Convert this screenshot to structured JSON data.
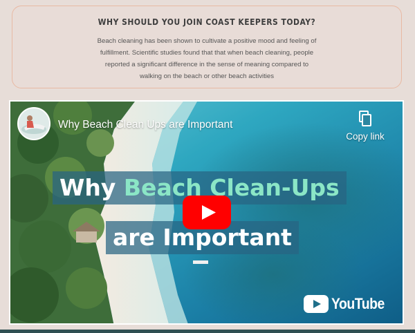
{
  "info_card": {
    "title": "WHY SHOULD YOU JOIN COAST KEEPERS TODAY?",
    "body_lines": [
      "Beach cleaning has been shown to cultivate a positive mood and feeling of",
      "fulfillment. Scientific studies found that that when beach cleaning, people",
      "reported a significant difference in the sense of meaning compared to",
      "walking on the beach or other beach activities"
    ]
  },
  "video": {
    "title": "Why Beach Clean Ups are Important",
    "copy_link_label": "Copy link",
    "overlay_line1_plain": "Why ",
    "overlay_line1_accent": "Beach Clean-Ups",
    "overlay_line2": "are Important",
    "platform_name": "YouTube",
    "icons": {
      "copy": "copy-icon",
      "play": "play-icon",
      "youtube": "youtube-logo-icon"
    },
    "colors": {
      "play_red": "#ff0000",
      "overlay_accent": "#8be6c6",
      "card_border": "#e8b9a3"
    }
  }
}
